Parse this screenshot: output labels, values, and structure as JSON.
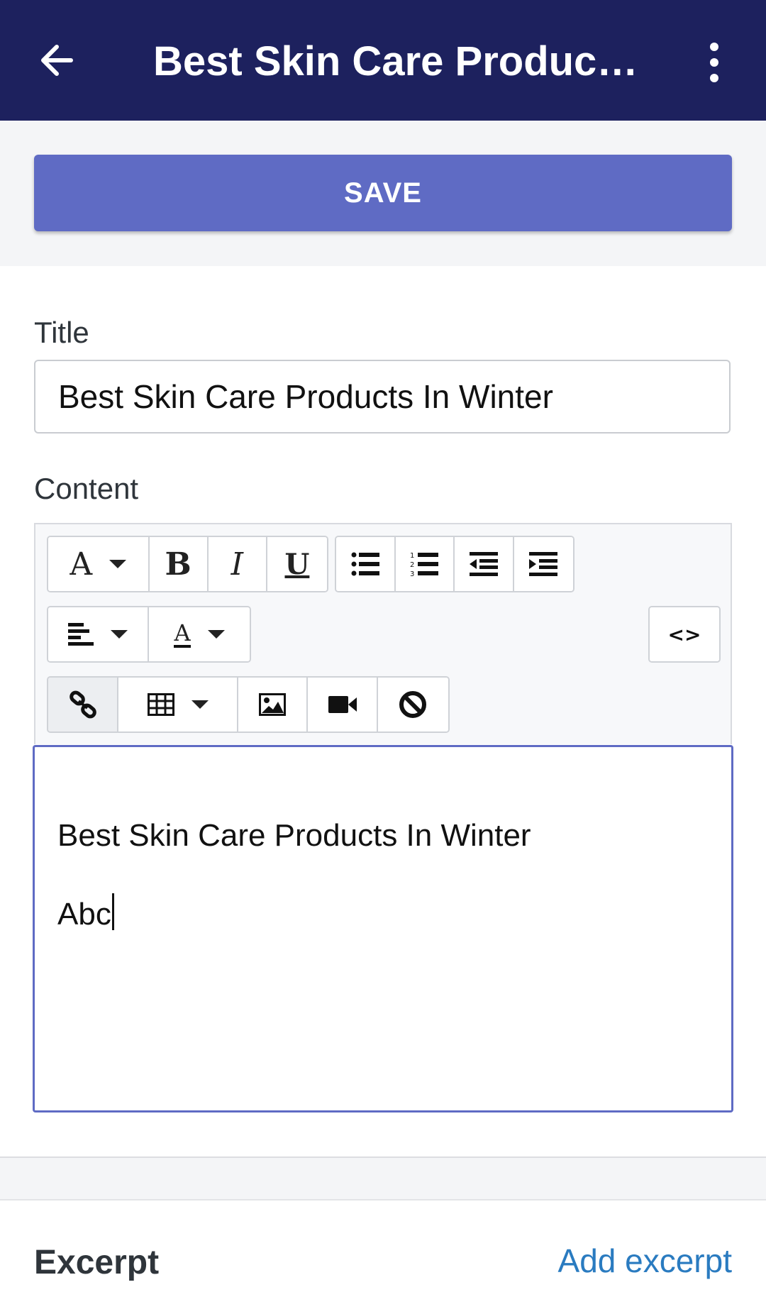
{
  "appbar": {
    "title": "Best Skin Care Products In Winter",
    "back_icon": "arrow-left-icon",
    "menu_icon": "more-vertical-icon",
    "color": "#1d215e"
  },
  "save": {
    "label": "SAVE",
    "color": "#5f6bc4"
  },
  "form": {
    "title_label": "Title",
    "title_value": "Best Skin Care Products In Winter",
    "content_label": "Content"
  },
  "toolbar": {
    "row1": [
      {
        "icon": "font-style-icon",
        "glyph": "A",
        "dropdown": true
      },
      {
        "icon": "bold-icon",
        "glyph": "B"
      },
      {
        "icon": "italic-icon",
        "glyph": "I"
      },
      {
        "icon": "underline-icon",
        "glyph": "U"
      },
      {
        "icon": "bulleted-list-icon"
      },
      {
        "icon": "numbered-list-icon"
      },
      {
        "icon": "outdent-icon"
      },
      {
        "icon": "indent-icon"
      }
    ],
    "row2": [
      {
        "icon": "align-left-icon",
        "dropdown": true
      },
      {
        "icon": "text-color-icon",
        "glyph": "A",
        "dropdown": true
      },
      {
        "icon": "code-view-icon",
        "glyph": "<>"
      }
    ],
    "row3": [
      {
        "icon": "link-icon",
        "active": true
      },
      {
        "icon": "table-icon",
        "dropdown": true
      },
      {
        "icon": "image-icon"
      },
      {
        "icon": "video-icon"
      },
      {
        "icon": "clear-format-icon"
      }
    ]
  },
  "editor": {
    "line1": "Best Skin Care Products In Winter",
    "line2": "Abc"
  },
  "excerpt": {
    "label": "Excerpt",
    "link": "Add excerpt",
    "link_color": "#2a7bc0"
  }
}
